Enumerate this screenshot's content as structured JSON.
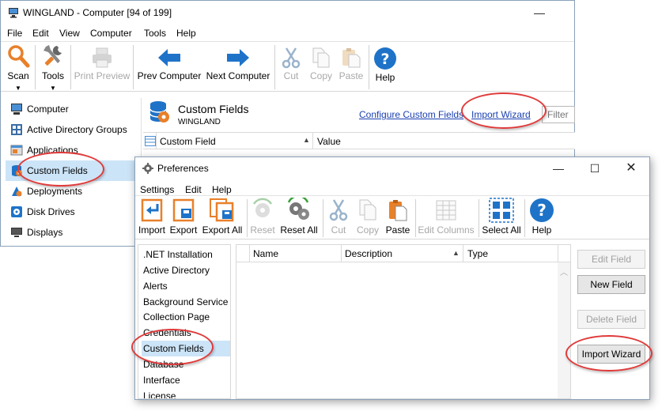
{
  "main_window": {
    "title": "WINGLAND - Computer [94 of 199]",
    "menu": [
      "File",
      "Edit",
      "View",
      "Computer",
      "Tools",
      "Help"
    ],
    "toolbar": {
      "scan": "Scan",
      "tools": "Tools",
      "print_preview": "Print Preview",
      "prev_computer": "Prev Computer",
      "next_computer": "Next Computer",
      "cut": "Cut",
      "copy": "Copy",
      "paste": "Paste",
      "help": "Help"
    },
    "nav": [
      {
        "label": "Computer",
        "icon": "computer-icon"
      },
      {
        "label": "Active Directory Groups",
        "icon": "ad-groups-icon"
      },
      {
        "label": "Applications",
        "icon": "applications-icon"
      },
      {
        "label": "Custom Fields",
        "icon": "custom-fields-icon",
        "selected": true
      },
      {
        "label": "Deployments",
        "icon": "deployments-icon"
      },
      {
        "label": "Disk Drives",
        "icon": "disk-drives-icon"
      },
      {
        "label": "Displays",
        "icon": "displays-icon"
      }
    ],
    "content": {
      "heading": "Custom Fields",
      "subheading": "WINGLAND",
      "configure_link": "Configure Custom Fields",
      "import_link": "Import Wizard",
      "filter_placeholder": "Filter",
      "columns": [
        "Custom Field",
        "Value"
      ]
    }
  },
  "prefs_window": {
    "title": "Preferences",
    "menu": [
      "Settings",
      "Edit",
      "Help"
    ],
    "toolbar": {
      "import": "Import",
      "export": "Export",
      "export_all": "Export All",
      "reset": "Reset",
      "reset_all": "Reset All",
      "cut": "Cut",
      "copy": "Copy",
      "paste": "Paste",
      "edit_columns": "Edit Columns",
      "select_all": "Select All",
      "help": "Help"
    },
    "categories": [
      ".NET Installation",
      "Active Directory",
      "Alerts",
      "Background Service",
      "Collection Page",
      "Credentials",
      "Custom Fields",
      "Database",
      "Interface",
      "License"
    ],
    "selected_category": "Custom Fields",
    "columns": [
      "Name",
      "Description",
      "Type"
    ],
    "buttons": {
      "edit_field": "Edit Field",
      "new_field": "New Field",
      "delete_field": "Delete Field",
      "import_wizard": "Import Wizard"
    }
  },
  "colors": {
    "accent_blue": "#1e73c8",
    "selection": "#cce4f7",
    "highlight_oval": "#e03a3a",
    "orange": "#e8802a"
  }
}
